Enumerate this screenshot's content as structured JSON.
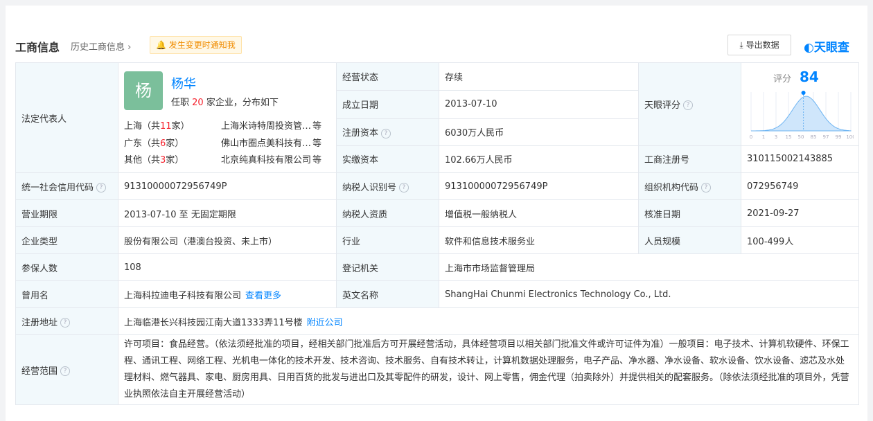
{
  "header": {
    "title": "工商信息",
    "history": "历史工商信息",
    "notify": "发生变更时通知我",
    "export": "导出数据",
    "logo": "天眼查"
  },
  "legal": {
    "label": "法定代表人",
    "avatar_char": "杨",
    "name": "杨华",
    "desc_prefix": "任职",
    "count": "20",
    "desc_suffix": "家企业，分布如下",
    "rows": [
      {
        "region": "上海（共",
        "n": "11",
        "suffix": "家）",
        "company": "上海米诗特周投资管…",
        "etc": "等"
      },
      {
        "region": "广东（共",
        "n": "6",
        "suffix": "家）",
        "company": "佛山市圈点美科技有…",
        "etc": "等"
      },
      {
        "region": "其他（共",
        "n": "3",
        "suffix": "家）",
        "company": "北京纯真科技有限公司",
        "etc": "等"
      }
    ]
  },
  "fields": {
    "status_label": "经营状态",
    "status": "存续",
    "score_label": "天眼评分",
    "score_title": "评分",
    "score": "84",
    "founded_label": "成立日期",
    "founded": "2013-07-10",
    "capital_label": "注册资本",
    "capital": "6030万人民币",
    "paid_label": "实缴资本",
    "paid": "102.66万人民币",
    "regno_label": "工商注册号",
    "regno": "310115002143885",
    "credit_label": "统一社会信用代码",
    "credit": "91310000072956749P",
    "taxid_label": "纳税人识别号",
    "taxid": "91310000072956749P",
    "org_label": "组织机构代码",
    "org": "072956749",
    "term_label": "营业期限",
    "term": "2013-07-10  至 无固定期限",
    "taxqual_label": "纳税人资质",
    "taxqual": "增值税一般纳税人",
    "approve_label": "核准日期",
    "approve": "2021-09-27",
    "type_label": "企业类型",
    "type": "股份有限公司（港澳台投资、未上市）",
    "industry_label": "行业",
    "industry": "软件和信息技术服务业",
    "staff_label": "人员规模",
    "staff": "100-499人",
    "insured_label": "参保人数",
    "insured": "108",
    "authority_label": "登记机关",
    "authority": "上海市市场监督管理局",
    "former_label": "曾用名",
    "former": "上海科拉迪电子科技有限公司",
    "former_more": "查看更多",
    "english_label": "英文名称",
    "english": "ShangHai Chunmi Electronics Technology Co., Ltd.",
    "address_label": "注册地址",
    "address": "上海临港长兴科技园江南大道1333弄11号楼",
    "address_near": "附近公司",
    "scope_label": "经营范围",
    "scope": "许可项目：食品经营。（依法须经批准的项目，经相关部门批准后方可开展经营活动，具体经营项目以相关部门批准文件或许可证件为准）一般项目：电子技术、计算机软硬件、环保工程、通讯工程、网络工程、光机电一体化的技术开发、技术咨询、技术服务、自有技术转让，计算机数据处理服务，电子产品、净水器、净水设备、软水设备、饮水设备、滤芯及水处理材料、燃气器具、家电、厨房用具、日用百货的批发与进出口及其零配件的研发，设计、网上零售，佣金代理（拍卖除外）并提供相关的配套服务。（除依法须经批准的项目外，凭营业执照依法自主开展经营活动）"
  },
  "chart_data": {
    "type": "area",
    "x_ticks": [
      "0",
      "1",
      "3",
      "15",
      "50",
      "85",
      "97",
      "99",
      "100"
    ],
    "marker_value": 84
  }
}
